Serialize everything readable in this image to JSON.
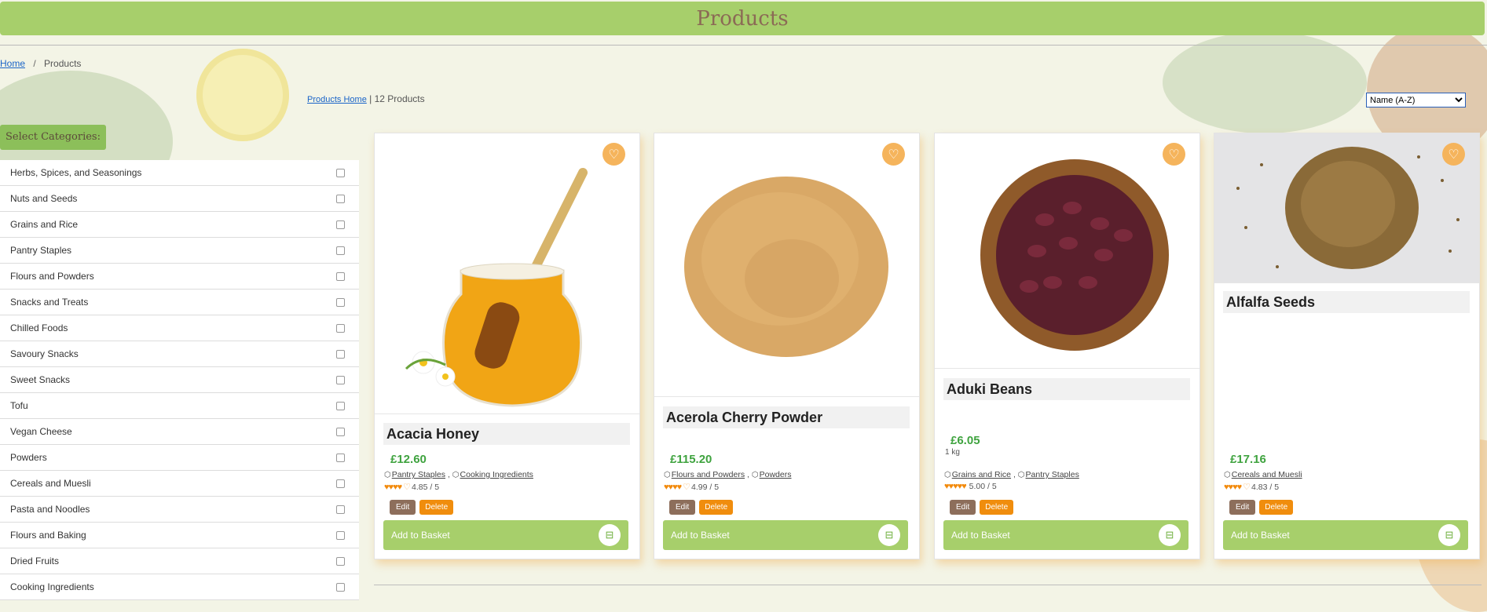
{
  "page": {
    "title": "Products"
  },
  "breadcrumb": {
    "home": "Home",
    "separator": "/",
    "current": "Products"
  },
  "products_info": {
    "link": "Products Home",
    "count": "| 12 Products"
  },
  "sort": {
    "selected": "Name (A-Z)"
  },
  "categories": {
    "header": "Select Categories:",
    "items": [
      "Herbs, Spices, and Seasonings",
      "Nuts and Seeds",
      "Grains and Rice",
      "Pantry Staples",
      "Flours and Powders",
      "Snacks and Treats",
      "Chilled Foods",
      "Savoury Snacks",
      "Sweet Snacks",
      "Tofu",
      "Vegan Cheese",
      "Powders",
      "Cereals and Muesli",
      "Pasta and Noodles",
      "Flours and Baking",
      "Dried Fruits",
      "Cooking Ingredients"
    ]
  },
  "card_labels": {
    "edit": "Edit",
    "delete": "Delete",
    "add_to_basket": "Add to Basket"
  },
  "products": [
    {
      "name": "Acacia Honey",
      "price": "£12.60",
      "weight": "",
      "tags": [
        "Pantry Staples",
        "Cooking Ingredients"
      ],
      "stars_filled": 4,
      "stars_empty": 1,
      "rating": "4.85 / 5",
      "image": "honey-jar"
    },
    {
      "name": "Acerola Cherry Powder",
      "price": "£115.20",
      "weight": "",
      "tags": [
        "Flours and Powders",
        "Powders"
      ],
      "stars_filled": 4,
      "stars_empty": 1,
      "rating": "4.99 / 5",
      "image": "powder-pile"
    },
    {
      "name": "Aduki Beans",
      "price": "£6.05",
      "weight": "1 kg",
      "tags": [
        "Grains and Rice",
        "Pantry Staples"
      ],
      "stars_filled": 5,
      "stars_empty": 0,
      "rating": "5.00 / 5",
      "image": "beans-bowl"
    },
    {
      "name": "Alfalfa Seeds",
      "price": "£17.16",
      "weight": "",
      "tags": [
        "Cereals and Muesli"
      ],
      "stars_filled": 4,
      "stars_empty": 1,
      "rating": "4.83 / 5",
      "image": "seeds-pile"
    }
  ],
  "colors": {
    "accent": "#a7cf6b",
    "price": "#3fa33f",
    "orange": "#f08d0d",
    "brown": "#8d6e5b"
  }
}
